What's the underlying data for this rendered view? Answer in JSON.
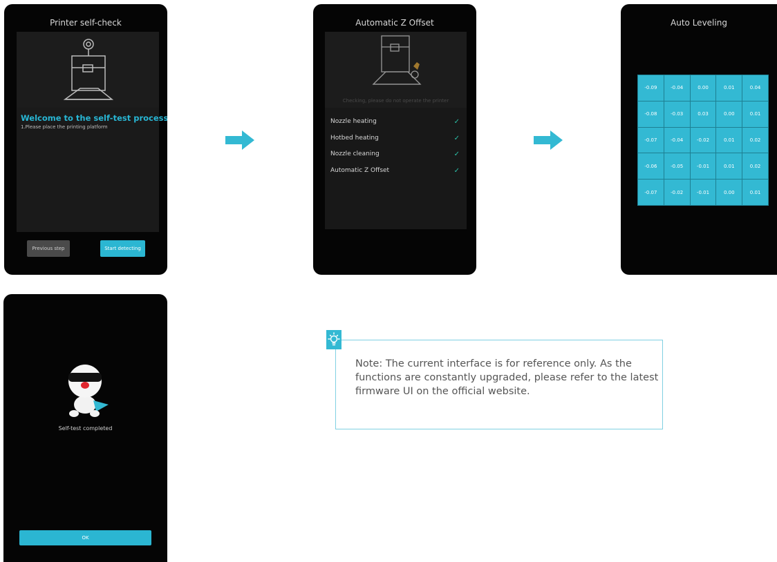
{
  "screen1": {
    "title": "Printer self-check",
    "welcome": "Welcome to the self-test process",
    "instruction": "1.Please place the printing platform",
    "prev_button": "Previous step",
    "start_button": "Start detecting"
  },
  "screen2": {
    "title": "Automatic Z Offset",
    "checking_text": "Checking, please do not operate the printer",
    "items": [
      {
        "label": "Nozzle heating",
        "status": "done"
      },
      {
        "label": "Hotbed heating",
        "status": "done"
      },
      {
        "label": "Nozzle cleaning",
        "status": "done"
      },
      {
        "label": "Automatic Z Offset",
        "status": "done"
      }
    ]
  },
  "screen3": {
    "title": "Auto Leveling",
    "grid": [
      [
        "-0.09",
        "-0.04",
        "0.00",
        "0.01",
        "0.04"
      ],
      [
        "-0.08",
        "-0.03",
        "0.03",
        "0.00",
        "0.01"
      ],
      [
        "-0.07",
        "-0.04",
        "-0.02",
        "0.01",
        "0.02"
      ],
      [
        "-0.06",
        "-0.05",
        "-0.01",
        "0.01",
        "0.02"
      ],
      [
        "-0.07",
        "-0.02",
        "-0.01",
        "0.00",
        "0.01"
      ]
    ]
  },
  "screen4": {
    "complete_text": "Self-test completed",
    "ok_button": "OK"
  },
  "note": {
    "text": "Note: The current interface is for reference only. As the functions are constantly upgraded, please refer to the latest firmware UI on the official website."
  },
  "colors": {
    "accent": "#2bb6d2",
    "check": "#2bc0a8",
    "screen_bg": "#050505"
  },
  "icons": [
    "printer-icon",
    "checkmark-icon",
    "arrow-right-icon",
    "lightbulb-icon",
    "mascot-icon"
  ]
}
